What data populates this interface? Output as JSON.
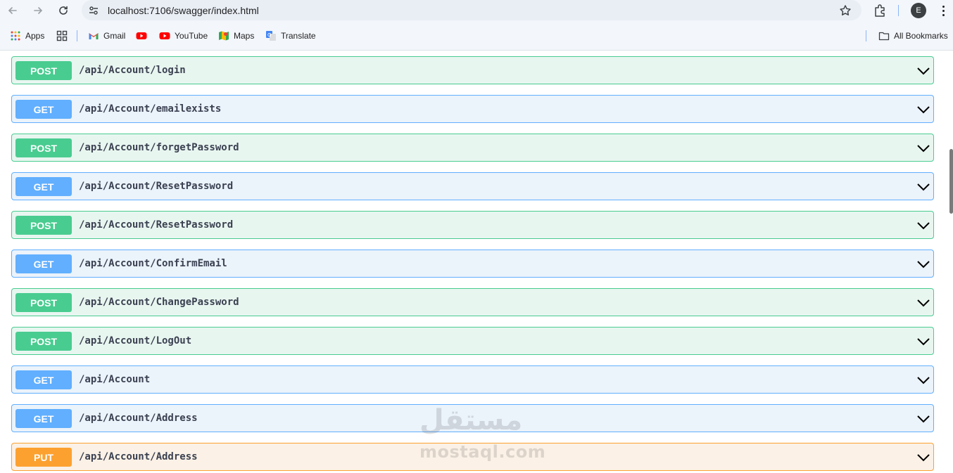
{
  "browser": {
    "url": "localhost:7106/swagger/index.html",
    "avatar_letter": "E",
    "bookmarks": [
      {
        "label": "Apps",
        "icon": "apps-grid-icon"
      },
      {
        "label": "",
        "icon": "tab-groups-icon"
      },
      {
        "label": "Gmail",
        "icon": "gmail-icon"
      },
      {
        "label": "",
        "icon": "youtube-icon"
      },
      {
        "label": "YouTube",
        "icon": "youtube-icon"
      },
      {
        "label": "Maps",
        "icon": "maps-icon"
      },
      {
        "label": "Translate",
        "icon": "translate-icon"
      }
    ],
    "all_bookmarks": "All Bookmarks"
  },
  "operations": [
    {
      "method": "POST",
      "path": "/api/Account/login"
    },
    {
      "method": "GET",
      "path": "/api/Account/emailexists"
    },
    {
      "method": "POST",
      "path": "/api/Account/forgetPassword"
    },
    {
      "method": "GET",
      "path": "/api/Account/ResetPassword"
    },
    {
      "method": "POST",
      "path": "/api/Account/ResetPassword"
    },
    {
      "method": "GET",
      "path": "/api/Account/ConfirmEmail"
    },
    {
      "method": "POST",
      "path": "/api/Account/ChangePassword"
    },
    {
      "method": "POST",
      "path": "/api/Account/LogOut"
    },
    {
      "method": "GET",
      "path": "/api/Account"
    },
    {
      "method": "GET",
      "path": "/api/Account/Address"
    },
    {
      "method": "PUT",
      "path": "/api/Account/Address"
    }
  ],
  "colors": {
    "post": "#49cc90",
    "get": "#61affe",
    "put": "#fca130"
  },
  "watermark": {
    "arabic": "مستقل",
    "latin": "mostaql.com"
  }
}
